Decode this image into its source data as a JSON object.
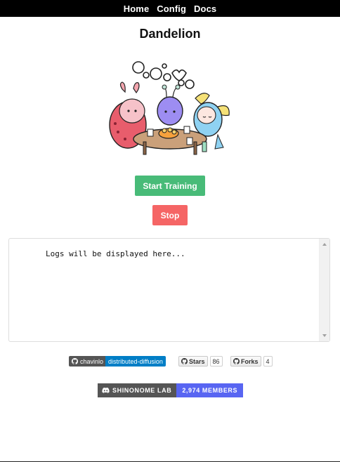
{
  "nav": {
    "items": [
      "Home",
      "Config",
      "Docs"
    ]
  },
  "page": {
    "title": "Dandelion"
  },
  "buttons": {
    "start": "Start Training",
    "stop": "Stop"
  },
  "logs": {
    "placeholder": "Logs will be displayed here..."
  },
  "badges": {
    "github": {
      "owner": "chavinlo",
      "repo": "distributed-diffusion"
    },
    "stars": {
      "label": "Stars",
      "count": "86"
    },
    "forks": {
      "label": "Forks",
      "count": "4"
    },
    "discord": {
      "server": "SHINONOME LAB",
      "members": "2,974 MEMBERS"
    }
  },
  "colors": {
    "start": "#48bb78",
    "stop": "#f56565",
    "discord": "#5865f2",
    "repo_badge": "#007ec6"
  }
}
